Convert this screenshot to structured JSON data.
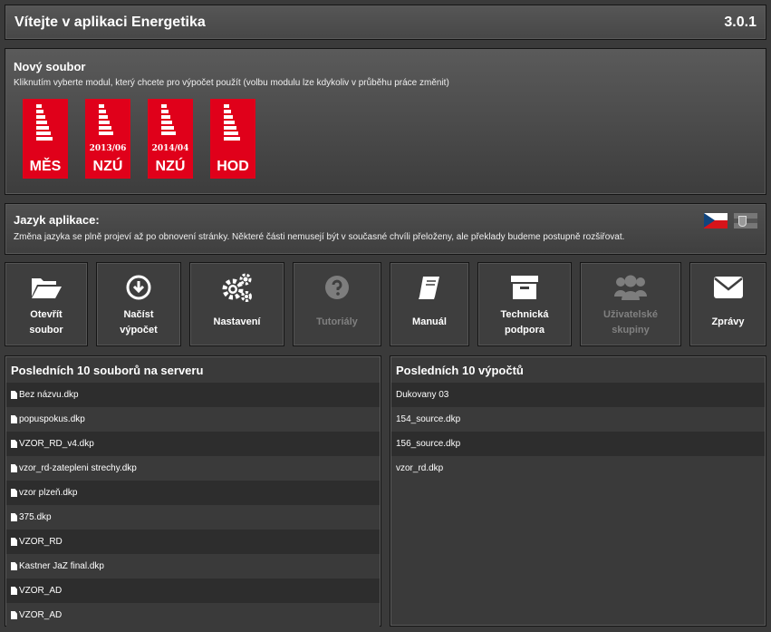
{
  "header": {
    "title": "Vítejte v aplikaci Energetika",
    "version": "3.0.1"
  },
  "new_file": {
    "title": "Nový soubor",
    "description": "Kliknutím vyberte modul, který chcete pro výpočet použít (volbu modulu lze kdykoliv v průběhu práce změnit)",
    "modules": [
      {
        "code": "MĚS",
        "date": ""
      },
      {
        "code": "NZÚ",
        "date": "2013/06"
      },
      {
        "code": "NZÚ",
        "date": "2014/04"
      },
      {
        "code": "HOD",
        "date": ""
      }
    ],
    "accent_color": "#e0001a"
  },
  "language": {
    "title": "Jazyk aplikace:",
    "description": "Změna jazyka se plně projeví až po obnovení stránky. Některé části nemusejí být v současné chvíli přeloženy, ale překlady budeme postupně rozšiřovat.",
    "flags": [
      "czech-flag",
      "slovak-flag"
    ]
  },
  "toolbar": {
    "open": "Otevřít\nsoubor",
    "load": "Načíst\nvýpočet",
    "settings": "Nastavení",
    "tutorials": "Tutoriály",
    "manual": "Manuál",
    "support": "Technická\npodpora",
    "groups": "Uživatelské\nskupiny",
    "messages": "Zprávy"
  },
  "recent_files": {
    "title": "Posledních 10 souborů na serveru",
    "items": [
      "Bez názvu.dkp",
      "popuspokus.dkp",
      "VZOR_RD_v4.dkp",
      "vzor_rd-zatepleni strechy.dkp",
      "vzor plzeň.dkp",
      "375.dkp",
      "VZOR_RD",
      "Kastner JaZ final.dkp",
      "VZOR_AD",
      "VZOR_AD"
    ]
  },
  "recent_calcs": {
    "title": "Posledních 10 výpočtů",
    "items": [
      "Dukovany 03",
      "154_source.dkp",
      "156_source.dkp",
      "vzor_rd.dkp"
    ]
  }
}
